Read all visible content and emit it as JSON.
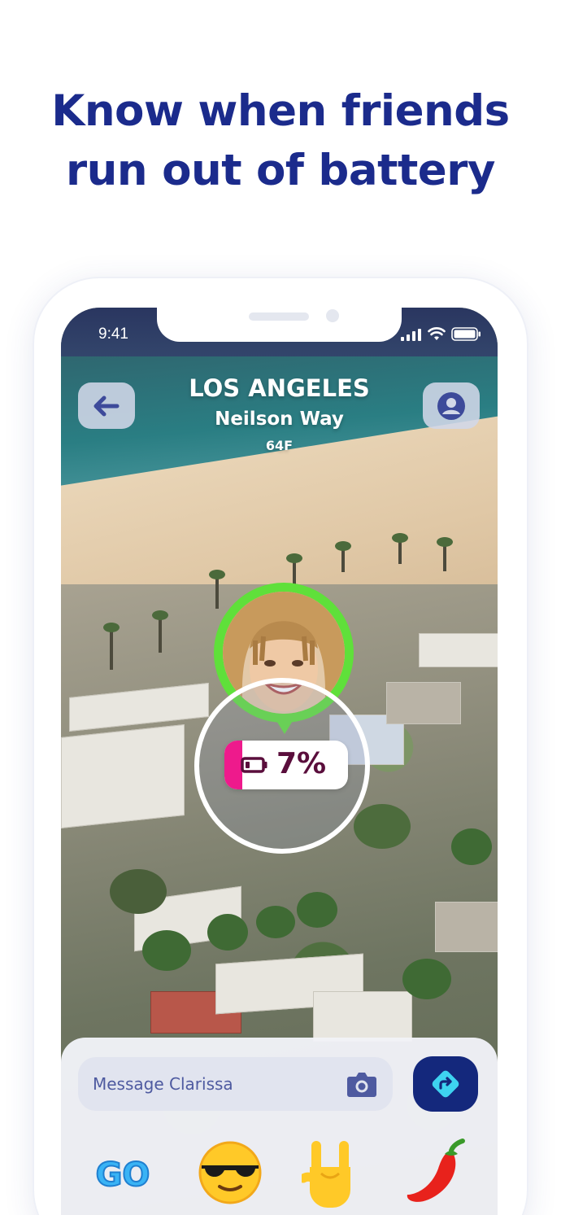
{
  "headline": {
    "line1": "Know when friends",
    "line2": "run out of battery"
  },
  "status_bar": {
    "time": "9:41",
    "icons": [
      "signal-icon",
      "wifi-icon",
      "battery-icon"
    ]
  },
  "header": {
    "city": "LOS ANGELES",
    "street": "Neilson Way",
    "temperature": "64F",
    "back_icon": "arrow-left-icon",
    "profile_icon": "user-icon"
  },
  "friend": {
    "name": "Clarissa",
    "battery_percent_label": "7%",
    "battery_level": 0.07,
    "pin_color": "#5fe03a",
    "battery_color": "#ee1a8c"
  },
  "composer": {
    "placeholder": "Message Clarissa",
    "camera_icon": "camera-icon",
    "send_icon": "directions-icon"
  },
  "quick_reactions": [
    {
      "name": "go-sticker",
      "label": "GO"
    },
    {
      "name": "cool-face-sunglasses-emoji",
      "label": ""
    },
    {
      "name": "rock-on-hand-emoji",
      "label": ""
    },
    {
      "name": "hot-pepper-emoji",
      "label": ""
    }
  ],
  "colors": {
    "headline": "#1b2b8c",
    "accent": "#14287c"
  }
}
